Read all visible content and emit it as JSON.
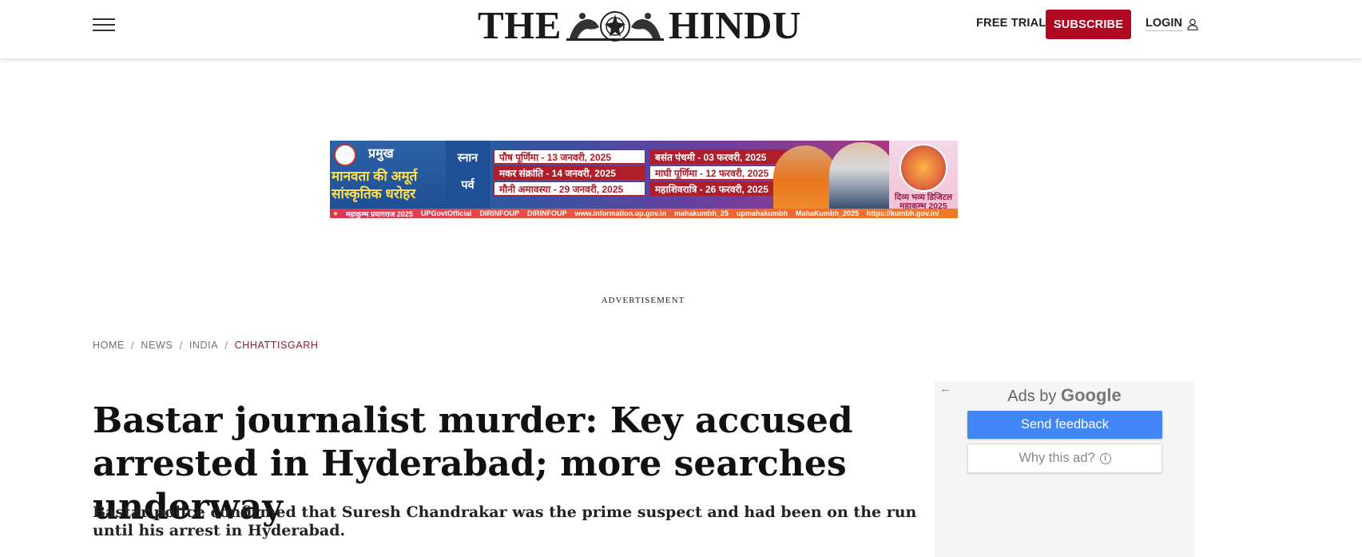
{
  "header": {
    "logo_left": "THE",
    "logo_right": "HINDU",
    "free_trial": "FREE TRIAL",
    "subscribe": "SUBSCRIBE",
    "login": "LOGIN",
    "accent_color": "#b10821"
  },
  "ad_banner": {
    "left_line1": "प्रमुख",
    "left_line2": "मानवता की अमूर्त",
    "left_line3": "सांस्कृतिक धरोहर",
    "mid_line1": "स्नान",
    "mid_line2": "पर्व",
    "dates_col1": [
      "पौष पूर्णिमा - 13 जनवरी, 2025",
      "मकर संक्रांति - 14 जनवरी, 2025",
      "मौनी अमावस्या - 29 जनवरी, 2025"
    ],
    "dates_col2": [
      "बसंत पंचमी - 03 फरवरी, 2025",
      "माघी पूर्णिमा - 12 फरवरी, 2025",
      "महाशिवरात्रि - 26 फरवरी, 2025"
    ],
    "right_text": "दिव्य भव्य डिजिटल महाकुम्भ 2025",
    "bottom_main": "महाकुम्भ प्रयागराज 2025",
    "bottom_links": [
      "UPGovtOfficial",
      "DIRINFOUP",
      "DIRINFOUP",
      "www.information.up.gov.in",
      "mahakumbh_25",
      "upmahakumbh",
      "MahaKumbh_2025",
      "https://kumbh.gov.in/"
    ]
  },
  "advertisement_label": "ADVERTISEMENT",
  "breadcrumb": {
    "items": [
      "HOME",
      "NEWS",
      "INDIA"
    ],
    "current": "CHHATTISGARH",
    "separator": "/"
  },
  "article": {
    "headline": "Bastar journalist murder: Key accused arrested in Hyderabad; more searches underway",
    "subhead": "Bastar police confirmed that Suresh Chandrakar was the prime suspect and had been on the run until his arrest in Hyderabad."
  },
  "side_ad": {
    "ads_by": "Ads by",
    "google": "Google",
    "send_feedback": "Send feedback",
    "why_this_ad": "Why this ad?"
  }
}
